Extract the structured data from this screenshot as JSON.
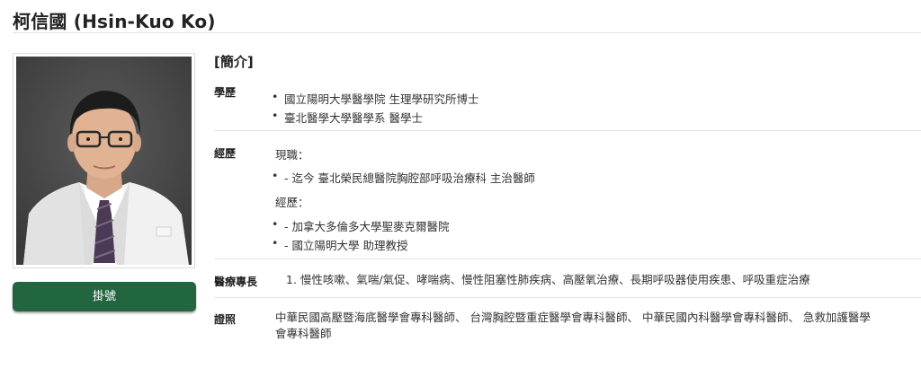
{
  "page": {
    "title": "柯信國 (Hsin-Kuo Ko)"
  },
  "actions": {
    "register_label": "掛號"
  },
  "profile": {
    "section_heading": "[簡介]",
    "education": {
      "label": "學歷",
      "items": [
        "國立陽明大學醫學院 生理學研究所博士",
        "臺北醫學大學醫學系 醫學士"
      ]
    },
    "experience": {
      "label": "經歷",
      "current_label": "現職：",
      "current_items": [
        "- 迄今 臺北榮民總醫院胸腔部呼吸治療科 主治醫師"
      ],
      "past_label": "經歷：",
      "past_items": [
        "- 加拿大多倫多大學聖麥克爾醫院",
        "- 國立陽明大學 助理教授"
      ]
    },
    "specialty": {
      "label": "醫療專長",
      "text": "1. 慢性咳嗽、氣喘/氣促、哮喘病、慢性阻塞性肺疾病、高壓氧治療、長期呼吸器使用疾患、呼吸重症治療"
    },
    "certificates": {
      "label": "證照",
      "line1": "中華民國高壓暨海底醫學會專科醫師、 台灣胸腔暨重症醫學會專科醫師、 中華民國內科醫學會專科醫師、 急救加護醫學",
      "line2": "會專科醫師"
    }
  },
  "colors": {
    "button": "#226640",
    "rule": "#e3e3e3",
    "photo_background": "#4a4a4a"
  }
}
